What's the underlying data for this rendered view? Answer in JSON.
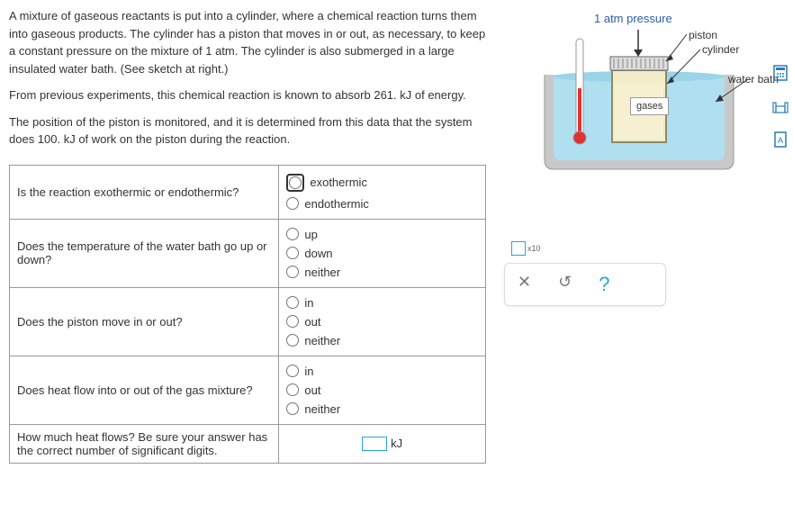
{
  "problem": {
    "p1": "A mixture of gaseous reactants is put into a cylinder, where a chemical reaction turns them into gaseous products. The cylinder has a piston that moves in or out, as necessary, to keep a constant pressure on the mixture of 1 atm. The cylinder is also submerged in a large insulated water bath. (See sketch at right.)",
    "p2": "From previous experiments, this chemical reaction is known to absorb 261. kJ of energy.",
    "p3": "The position of the piston is monitored, and it is determined from this data that the system does 100. kJ of work on the piston during the reaction."
  },
  "table": {
    "q1": "Is the reaction exothermic or endothermic?",
    "q1_opts": {
      "a": "exothermic",
      "b": "endothermic"
    },
    "q2": "Does the temperature of the water bath go up or down?",
    "q2_opts": {
      "a": "up",
      "b": "down",
      "c": "neither"
    },
    "q3": "Does the piston move in or out?",
    "q3_opts": {
      "a": "in",
      "b": "out",
      "c": "neither"
    },
    "q4": "Does heat flow into or out of the gas mixture?",
    "q4_opts": {
      "a": "in",
      "b": "out",
      "c": "neither"
    },
    "q5": "How much heat flows? Be sure your answer has the correct number of significant digits.",
    "q5_unit": "kJ"
  },
  "diagram": {
    "pressure": "1 atm pressure",
    "piston": "piston",
    "cylinder": "cylinder",
    "waterbath": "water bath",
    "gases": "gases"
  },
  "controls": {
    "scale": "x10",
    "close": "✕",
    "undo": "↺",
    "help": "?"
  }
}
